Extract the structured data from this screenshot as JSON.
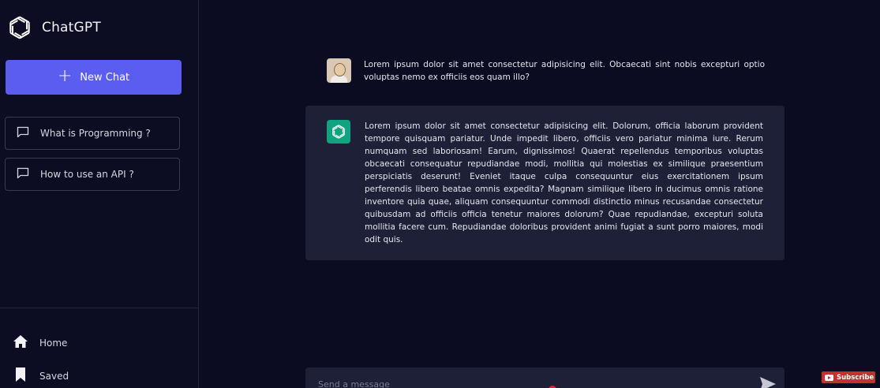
{
  "sidebar": {
    "brand": "ChatGPT",
    "new_chat_label": "New Chat",
    "history": [
      {
        "label": "What is Programming ?"
      },
      {
        "label": "How to use an API ?"
      }
    ],
    "nav": {
      "home": "Home",
      "saved": "Saved"
    }
  },
  "conversation": {
    "user_message": "Lorem ipsum dolor sit amet consectetur adipisicing elit. Obcaecati sint nobis excepturi optio voluptas nemo ex officiis eos quam illo?",
    "bot_message": "Lorem ipsum dolor sit amet consectetur adipisicing elit. Dolorum, officia laborum provident tempore quisquam pariatur. Unde impedit libero, officiis vero pariatur minima iure. Rerum numquam sed laboriosam! Earum, dignissimos! Quaerat repellendus temporibus voluptas obcaecati consequatur repudiandae modi, mollitia qui molestias ex similique praesentium perspiciatis deserunt! Eveniet itaque culpa consequuntur eius exercitationem ipsum perferendis libero beatae omnis expedita? Magnam similique libero in ducimus omnis ratione inventore quia quae, aliquam consequuntur commodi distinctio minus recusandae consectetur quibusdam ad officiis officia tenetur maiores dolorum? Quae repudiandae, excepturi soluta mollitia facere cum. Repudiandae doloribus provident animi fugiat a sunt porro maiores, modi odit quis."
  },
  "input": {
    "placeholder": "Send a message"
  },
  "overlay": {
    "subscribe_label": "Subscribe"
  },
  "colors": {
    "background": "#0b0c22",
    "accent": "#5b5cf0",
    "bot_bubble": "#1e2038",
    "bot_avatar": "#10a37f",
    "subscribe": "#c4302b"
  },
  "icons": {
    "brand": "openai-logo-icon",
    "new_chat": "plus-icon",
    "history": "chat-bubble-icon",
    "home": "home-icon",
    "saved": "bookmark-icon",
    "send": "send-icon"
  }
}
